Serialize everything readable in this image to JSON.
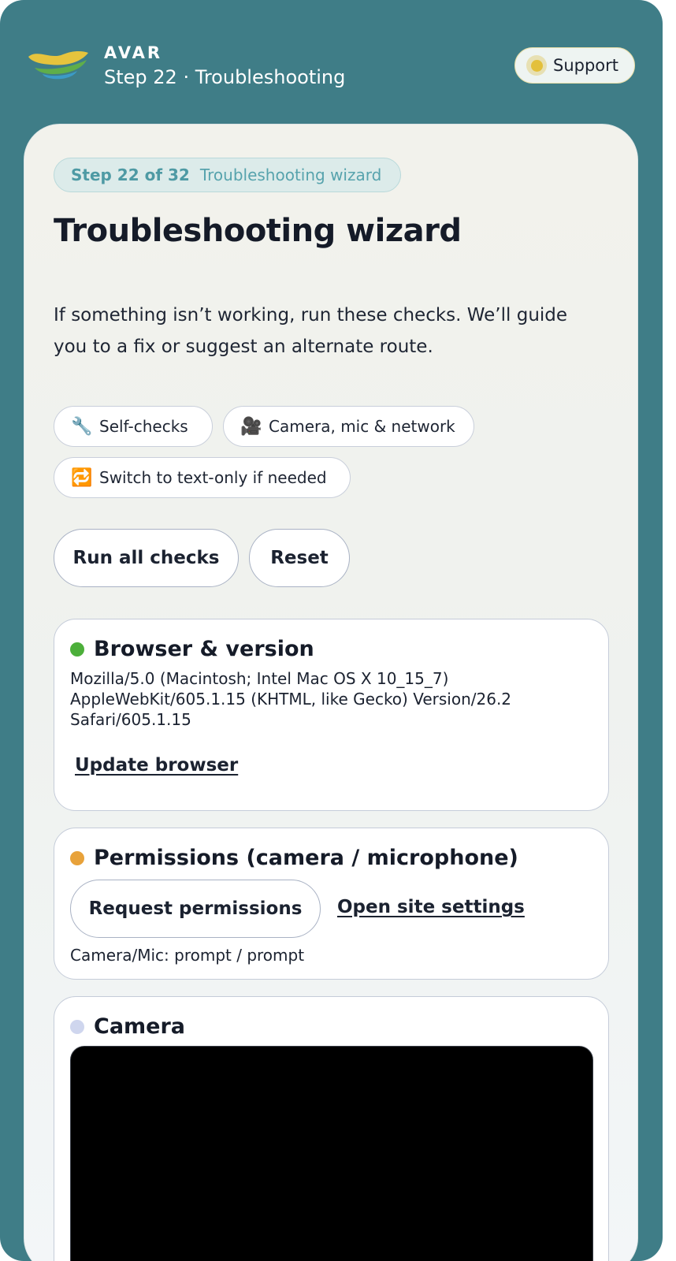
{
  "header": {
    "brand": "AVAR",
    "subtitle": "Step 22 · Troubleshooting",
    "support_label": "Support"
  },
  "card": {
    "step_count": "Step 22 of 32",
    "step_name": "Troubleshooting wizard",
    "title": "Troubleshooting wizard",
    "description": "If something isn’t working, run these checks. We’ll guide you to a fix or suggest an alternate route.",
    "chips": [
      {
        "icon": "wrench-icon",
        "glyph": "🔧",
        "label": "Self-checks"
      },
      {
        "icon": "movie-camera-icon",
        "glyph": "🎥",
        "label": "Camera, mic & network"
      },
      {
        "icon": "repeat-icon",
        "glyph": "🔁",
        "label": "Switch to text-only if needed"
      }
    ],
    "actions": {
      "run_all": "Run all checks",
      "reset": "Reset"
    }
  },
  "sections": {
    "browser": {
      "title": "Browser & version",
      "status_color": "#4caf3a",
      "user_agent": "Mozilla/5.0 (Macintosh; Intel Mac OS X 10_15_7) AppleWebKit/605.1.15 (KHTML, like Gecko) Version/26.2 Safari/605.1.15",
      "update_link": "Update browser"
    },
    "permissions": {
      "title": "Permissions (camera / microphone)",
      "status_color": "#e8a23a",
      "request_button": "Request permissions",
      "settings_link": "Open site settings",
      "status_text": "Camera/Mic: prompt / prompt"
    },
    "camera": {
      "title": "Camera",
      "status_color": "#cfd6ee"
    }
  },
  "colors": {
    "background": "#3f7d87",
    "accent": "#4e9aa4",
    "support_dot": "#e3c03b"
  }
}
